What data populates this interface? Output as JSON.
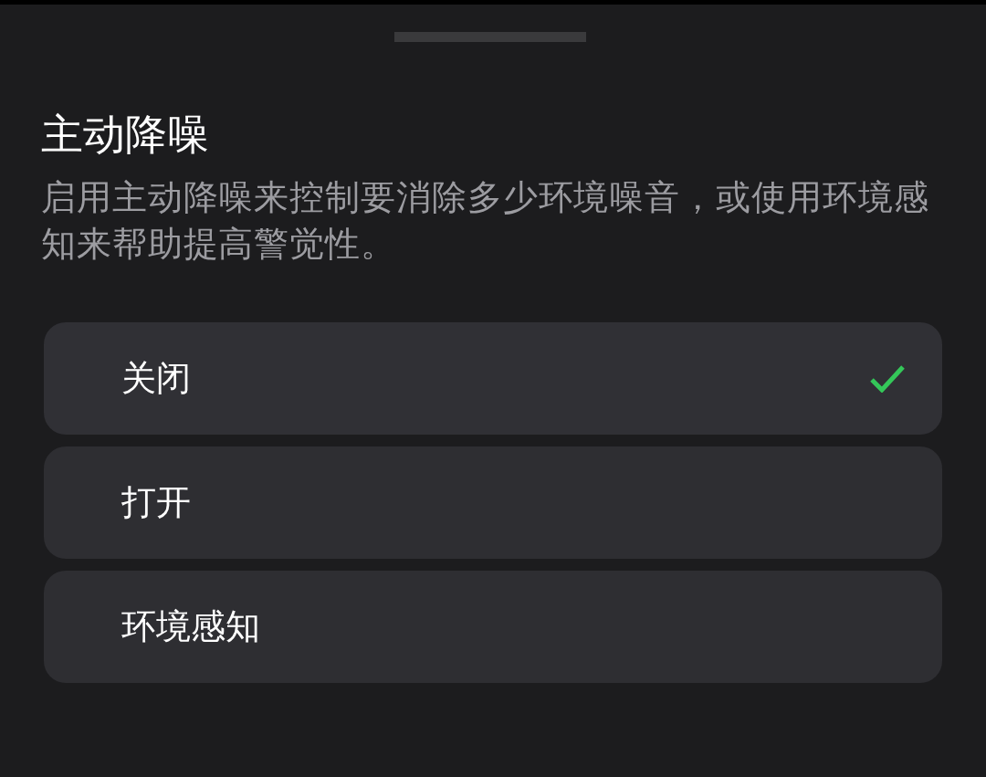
{
  "sheet": {
    "title": "主动降噪",
    "description": "启用主动降噪来控制要消除多少环境噪音，或使用环境感知来帮助提高警觉性。"
  },
  "options": [
    {
      "label": "关闭",
      "selected": true
    },
    {
      "label": "打开",
      "selected": false
    },
    {
      "label": "环境感知",
      "selected": false
    }
  ]
}
